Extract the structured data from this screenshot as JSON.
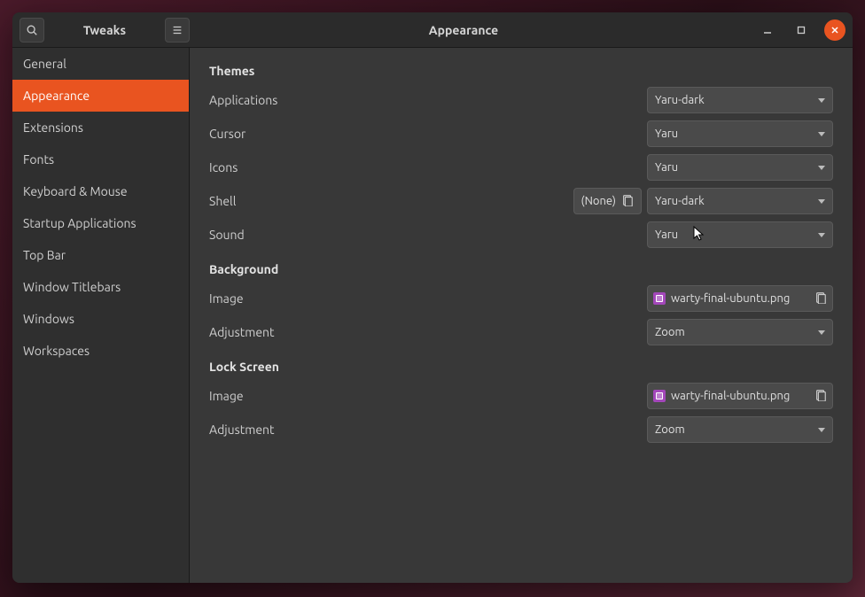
{
  "app": {
    "name": "Tweaks"
  },
  "header": {
    "title": "Appearance"
  },
  "sidebar": {
    "active": "Appearance",
    "items": [
      {
        "label": "General"
      },
      {
        "label": "Appearance"
      },
      {
        "label": "Extensions"
      },
      {
        "label": "Fonts"
      },
      {
        "label": "Keyboard & Mouse"
      },
      {
        "label": "Startup Applications"
      },
      {
        "label": "Top Bar"
      },
      {
        "label": "Window Titlebars"
      },
      {
        "label": "Windows"
      },
      {
        "label": "Workspaces"
      }
    ]
  },
  "sections": {
    "themes": {
      "title": "Themes",
      "applications": {
        "label": "Applications",
        "value": "Yaru-dark"
      },
      "cursor": {
        "label": "Cursor",
        "value": "Yaru"
      },
      "icons": {
        "label": "Icons",
        "value": "Yaru"
      },
      "shell": {
        "label": "Shell",
        "value": "Yaru-dark",
        "aux": "(None)"
      },
      "sound": {
        "label": "Sound",
        "value": "Yaru"
      }
    },
    "background": {
      "title": "Background",
      "image": {
        "label": "Image",
        "file": "warty-final-ubuntu.png"
      },
      "adjustment": {
        "label": "Adjustment",
        "value": "Zoom"
      }
    },
    "lockscreen": {
      "title": "Lock Screen",
      "image": {
        "label": "Image",
        "file": "warty-final-ubuntu.png"
      },
      "adjustment": {
        "label": "Adjustment",
        "value": "Zoom"
      }
    }
  }
}
